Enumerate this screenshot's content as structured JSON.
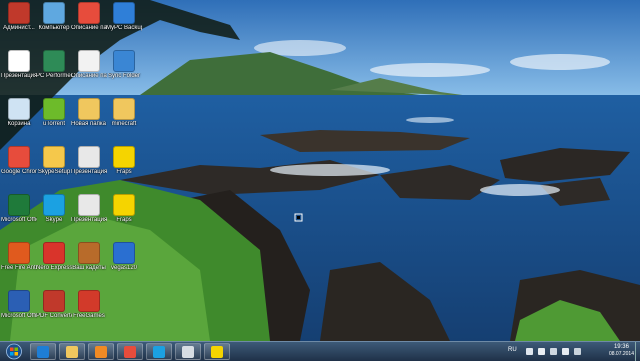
{
  "desktop": {
    "icons": [
      {
        "label": "Админист...",
        "icon": "admin-9-icon",
        "color": "#c0392b",
        "col": 0,
        "row": 0
      },
      {
        "label": "Компьютер",
        "icon": "computer-icon",
        "color": "#5fa8e0",
        "col": 1,
        "row": 0
      },
      {
        "label": "Описание пасьянса ...",
        "icon": "chrome-icon",
        "color": "#e74c3c",
        "col": 2,
        "row": 0
      },
      {
        "label": "MyPC Backup",
        "icon": "mypc-backup-icon",
        "color": "#2f7fd8",
        "col": 3,
        "row": 0
      },
      {
        "label": "Презентация №4",
        "icon": "presentation-icon",
        "color": "#ffffff",
        "col": 0,
        "row": 1
      },
      {
        "label": "PC Performer",
        "icon": "pc-performer-icon",
        "color": "#2e8b57",
        "col": 1,
        "row": 1
      },
      {
        "label": "Описание пасьянса ...",
        "icon": "document-icon",
        "color": "#f2f2f2",
        "col": 2,
        "row": 1
      },
      {
        "label": "Sync Folder",
        "icon": "sync-folder-icon",
        "color": "#3a86d4",
        "col": 3,
        "row": 1
      },
      {
        "label": "Корзина",
        "icon": "recycle-bin-icon",
        "color": "#cfe3f3",
        "col": 0,
        "row": 2
      },
      {
        "label": "uTorrent",
        "icon": "utorrent-icon",
        "color": "#6dbb2a",
        "col": 1,
        "row": 2
      },
      {
        "label": "Новая папка (2)",
        "icon": "folder-icon",
        "color": "#f0c75e",
        "col": 2,
        "row": 2
      },
      {
        "label": "minecraft",
        "icon": "folder-icon",
        "color": "#f0c75e",
        "col": 3,
        "row": 2
      },
      {
        "label": "Google Chrome",
        "icon": "chrome-icon",
        "color": "#e74c3c",
        "col": 0,
        "row": 3
      },
      {
        "label": "SkypeSetup",
        "icon": "skype-setup-icon",
        "color": "#f5c84b",
        "col": 1,
        "row": 3
      },
      {
        "label": "Презентация №1",
        "icon": "presentation-icon",
        "color": "#e8e8e8",
        "col": 2,
        "row": 3
      },
      {
        "label": "Fraps",
        "icon": "fraps-icon",
        "color": "#f5d400",
        "col": 3,
        "row": 3
      },
      {
        "label": "Microsoft Office Exc...",
        "icon": "excel-icon",
        "color": "#1f7a3a",
        "col": 0,
        "row": 4
      },
      {
        "label": "Skype",
        "icon": "skype-icon",
        "color": "#1ba1e2",
        "col": 1,
        "row": 4
      },
      {
        "label": "Презентация №2",
        "icon": "presentation-icon",
        "color": "#e8e8e8",
        "col": 2,
        "row": 4
      },
      {
        "label": "Fraps",
        "icon": "fraps-icon",
        "color": "#f5d400",
        "col": 3,
        "row": 4
      },
      {
        "label": "Free Fire Antivirus",
        "icon": "antivirus-icon",
        "color": "#e05a1e",
        "col": 0,
        "row": 5
      },
      {
        "label": "Nero Express",
        "icon": "nero-icon",
        "color": "#d9342b",
        "col": 1,
        "row": 5
      },
      {
        "label": "Ваш кадеты",
        "icon": "game-icon",
        "color": "#b86b2a",
        "col": 2,
        "row": 5
      },
      {
        "label": "vegas120",
        "icon": "vegas-icon",
        "color": "#2a6fd1",
        "col": 3,
        "row": 5
      },
      {
        "label": "Microsoft Office Wo...",
        "icon": "word-icon",
        "color": "#2b5fb4",
        "col": 0,
        "row": 6
      },
      {
        "label": "PDF Converter",
        "icon": "pdf-converter-icon",
        "color": "#c0392b",
        "col": 1,
        "row": 6
      },
      {
        "label": "FreeGames",
        "icon": "freegames-icon",
        "color": "#d23a2a",
        "col": 2,
        "row": 6
      }
    ]
  },
  "taskbar": {
    "start": {
      "icon": "windows-start-icon"
    },
    "pinned": [
      {
        "icon": "internet-explorer-icon",
        "color": "#1e7ed6"
      },
      {
        "icon": "file-explorer-icon",
        "color": "#f0c75e"
      },
      {
        "icon": "media-player-icon",
        "color": "#f08a24"
      },
      {
        "icon": "chrome-icon",
        "color": "#e74c3c"
      },
      {
        "icon": "skype-icon",
        "color": "#1ba1e2"
      },
      {
        "icon": "webcam-icon",
        "color": "#d7dde3"
      },
      {
        "icon": "fraps-icon",
        "color": "#f5d400"
      }
    ],
    "tray": {
      "language": "RU",
      "icons": [
        "tray-arrow-icon",
        "flag-icon",
        "network-icon",
        "volume-icon",
        "power-icon"
      ],
      "time": "19:36",
      "date": "08.07.2014"
    }
  },
  "colors": {
    "sky": "#3f83c9",
    "ocean": "#1c5f9e",
    "rock": "#2e2a27",
    "foliage": "#3f8a2c",
    "taskbar": "#2a4360"
  }
}
